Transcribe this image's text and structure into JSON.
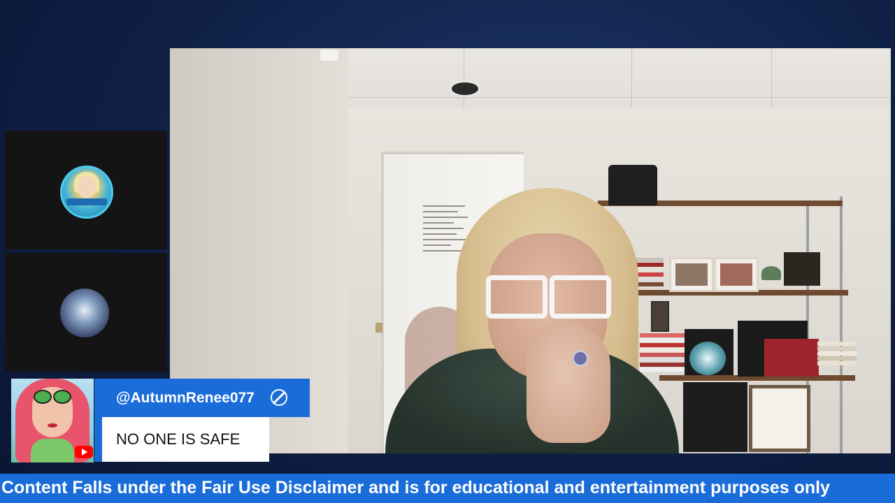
{
  "comment": {
    "username": "@AutumnRenee077",
    "message": "NO ONE IS SAFE",
    "platform_icon": "youtube-icon",
    "badge_icon": "ban-icon"
  },
  "ticker": {
    "text": "Content Falls under the Fair Use Disclaimer and is for educational and entertainment purposes only"
  },
  "participants": [
    {
      "avatar_icon": "participant-avatar-icon"
    },
    {
      "avatar_icon": "participant-avatar-icon"
    }
  ],
  "colors": {
    "accent": "#1a6dd9",
    "background": "#0f1f44",
    "tile_bg": "#141414"
  }
}
